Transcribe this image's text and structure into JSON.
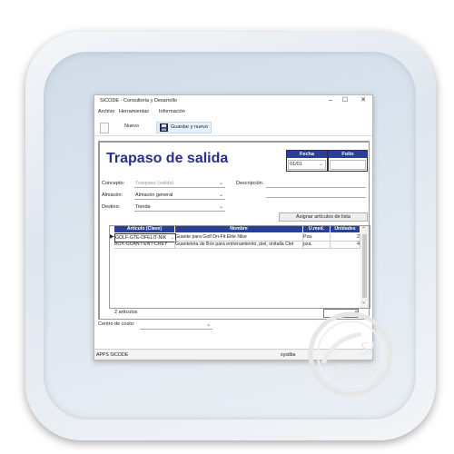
{
  "window": {
    "title": "SICODE - Consultoría y Desarrollo",
    "minimize": "–",
    "maximize": "☐",
    "close": "✕"
  },
  "menu": [
    "Archivo",
    "Herramientas",
    "Información"
  ],
  "toolbar": {
    "new_label": "Nuevo",
    "save_new_label": "Guardar y nuevo"
  },
  "form": {
    "title": "Trapaso de salida",
    "fecha": {
      "label": "Fecha",
      "value": "01/01"
    },
    "folio": {
      "label": "Folio",
      "value": ""
    },
    "concepto": {
      "label": "Concepto:",
      "value": "Traspaso (salida)"
    },
    "descripcion": {
      "label": "Descripción:",
      "value": ""
    },
    "almacen": {
      "label": "Almacén:",
      "value": "Almacén general"
    },
    "destino": {
      "label": "Destino:",
      "value": "Tienda"
    },
    "assign_button": "Asignar artículos de lista"
  },
  "grid": {
    "columns": [
      "Artículo (Clave)",
      "Nombre",
      "U.med.",
      "Unidades"
    ],
    "rows": [
      {
        "clave": "GOLF-GTE-DFELIT-NIK",
        "nombre": "Guante para Golf Dri-Fit Elite Nike",
        "umed": "Pza.",
        "unidades": "2"
      },
      {
        "clave": "BOX-GUANT-ENT-CREY",
        "nombre": "Guanteleta de Box para entrenamiento, piel, unitalla Clet",
        "umed": "pza.",
        "unidades": "4"
      }
    ]
  },
  "footer": {
    "count_label": "2 artículos",
    "total": "6",
    "centro_label": "Centro de costo:",
    "centro_value": ""
  },
  "status": {
    "app": "APPS SICODE",
    "user": "sysdba"
  },
  "watermark": {
    "line1": "SI",
    "line2": "CODE"
  }
}
